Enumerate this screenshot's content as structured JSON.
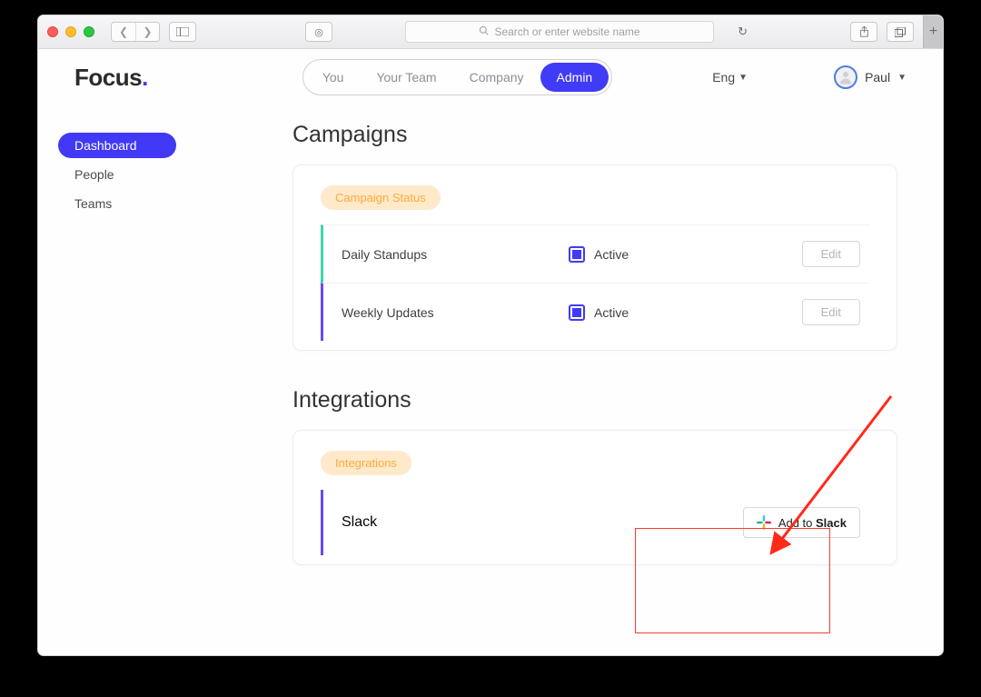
{
  "browser": {
    "placeholder": "Search or enter website name"
  },
  "logo": {
    "text": "Focus",
    "punct": "."
  },
  "nav": {
    "you": "You",
    "team": "Your Team",
    "company": "Company",
    "admin": "Admin"
  },
  "lang": "Eng",
  "user": {
    "name": "Paul"
  },
  "sidebar": {
    "dashboard": "Dashboard",
    "people": "People",
    "teams": "Teams"
  },
  "campaigns": {
    "title": "Campaigns",
    "badge": "Campaign Status",
    "rows": [
      {
        "name": "Daily Standups",
        "status": "Active",
        "edit": "Edit"
      },
      {
        "name": "Weekly Updates",
        "status": "Active",
        "edit": "Edit"
      }
    ]
  },
  "integrations": {
    "title": "Integrations",
    "badge": "Integrations",
    "slack": {
      "name": "Slack",
      "btn_prefix": "Add to ",
      "btn_bold": "Slack"
    }
  }
}
